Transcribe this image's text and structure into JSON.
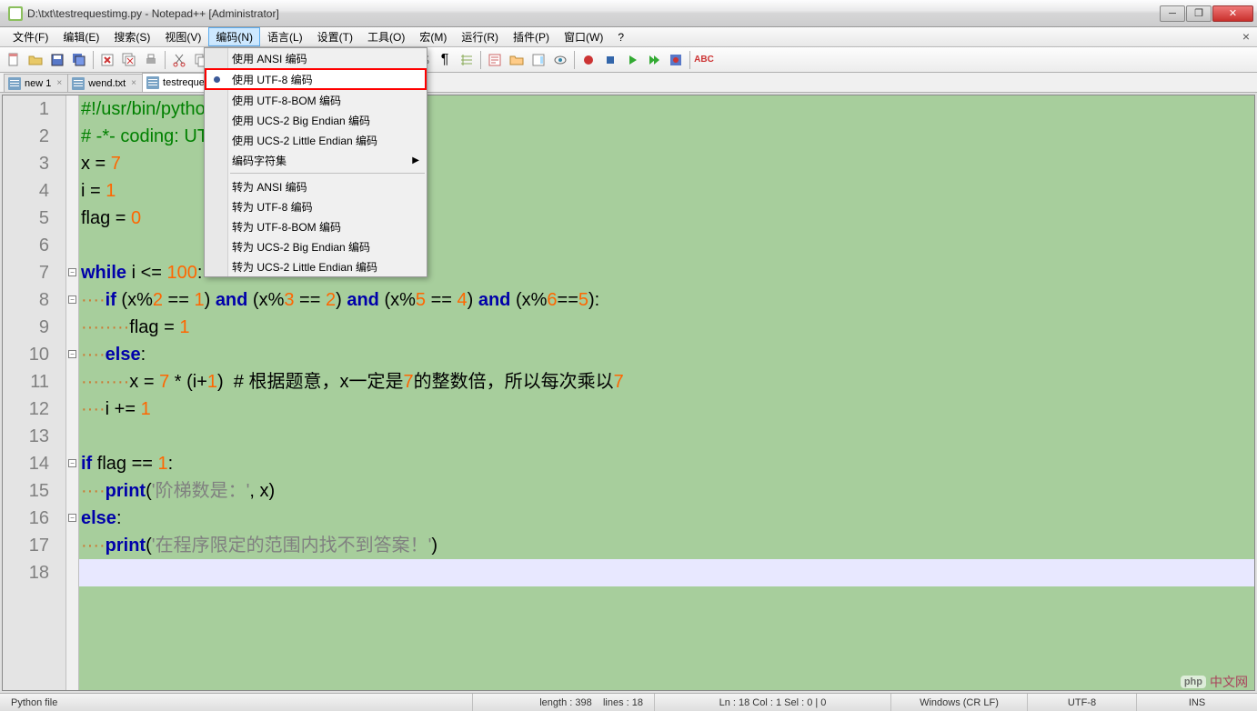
{
  "window": {
    "title": "D:\\txt\\testrequestimg.py - Notepad++ [Administrator]"
  },
  "menubar": {
    "items": [
      "文件(F)",
      "编辑(E)",
      "搜索(S)",
      "视图(V)",
      "编码(N)",
      "语言(L)",
      "设置(T)",
      "工具(O)",
      "宏(M)",
      "运行(R)",
      "插件(P)",
      "窗口(W)",
      "?"
    ],
    "active_index": 4
  },
  "dropdown": {
    "items": [
      {
        "label": "使用 ANSI 编码",
        "type": "radio"
      },
      {
        "label": "使用 UTF-8 编码",
        "type": "radio",
        "checked": true,
        "highlighted": true
      },
      {
        "label": "使用 UTF-8-BOM 编码",
        "type": "radio"
      },
      {
        "label": "使用 UCS-2 Big Endian 编码",
        "type": "radio"
      },
      {
        "label": "使用 UCS-2 Little Endian 编码",
        "type": "radio"
      },
      {
        "label": "编码字符集",
        "type": "submenu"
      },
      {
        "type": "sep"
      },
      {
        "label": "转为 ANSI 编码",
        "type": "item"
      },
      {
        "label": "转为 UTF-8 编码",
        "type": "item"
      },
      {
        "label": "转为 UTF-8-BOM 编码",
        "type": "item"
      },
      {
        "label": "转为 UCS-2 Big Endian 编码",
        "type": "item"
      },
      {
        "label": "转为 UCS-2 Little Endian 编码",
        "type": "item"
      }
    ]
  },
  "tabs": [
    {
      "label": "new 1",
      "active": false
    },
    {
      "label": "wend.txt",
      "active": false
    },
    {
      "label": "testrequestimg.py",
      "active": true
    }
  ],
  "code": {
    "lines": [
      "#!/usr/bin/python3",
      "# -*- coding: UTF-8 -*-",
      "x = 7",
      "i = 1",
      "flag = 0",
      "",
      "while i <= 100:",
      "    if (x%2 == 1) and (x%3 == 2) and (x%5 == 4) and (x%6==5):",
      "        flag = 1",
      "    else:",
      "        x = 7 * (i+1)  # 根据题意，x一定是7的整数倍，所以每次乘以7",
      "    i += 1",
      "",
      "if flag == 1:",
      "    print('阶梯数是：', x)",
      "else:",
      "    print('在程序限定的范围内找不到答案！')",
      ""
    ],
    "current_line": 18
  },
  "statusbar": {
    "filetype": "Python file",
    "length_label": "length : 398",
    "lines_label": "lines : 18",
    "pos_label": "Ln : 18    Col : 1    Sel : 0 | 0",
    "eol": "Windows (CR LF)",
    "encoding": "UTF-8",
    "mode": "INS"
  },
  "watermark": {
    "brand": "php",
    "text": "中文网"
  }
}
